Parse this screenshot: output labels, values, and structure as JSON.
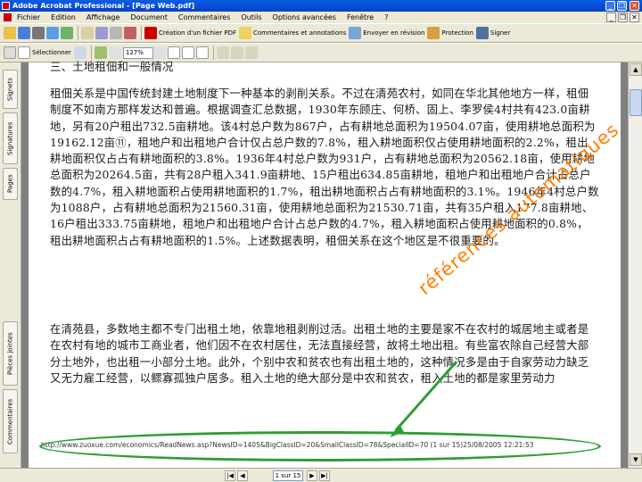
{
  "window": {
    "title": "Adobe Acrobat Professional - [Page Web.pdf]",
    "minimize": "_",
    "restore": "❐",
    "close": "✕"
  },
  "menu": [
    {
      "label": "Fichier"
    },
    {
      "label": "Edition"
    },
    {
      "label": "Affichage"
    },
    {
      "label": "Document"
    },
    {
      "label": "Commentaires"
    },
    {
      "label": "Outils"
    },
    {
      "label": "Options avancées"
    },
    {
      "label": "Fenêtre"
    },
    {
      "label": "?"
    }
  ],
  "toolbar1": {
    "create_pdf": "Création d'un fichier PDF",
    "comment_markup": "Commentaires et annotations",
    "send_for_review": "Envoyer en révision",
    "protection": "Protection",
    "sign": "Signer"
  },
  "toolbar2": {
    "select_tool": "Sélectionner",
    "zoom_value": "127%"
  },
  "navpane": {
    "bookmarks": "Signets",
    "signatures": "Signatures",
    "pages": "Pages",
    "attachments": "Pièces jointes",
    "comments": "Commentaires"
  },
  "document": {
    "heading": "三、土地租佃和一般情况",
    "paragraph1": "租佃关系是中国传统封建土地制度下一种基本的剥削关系。不过在清苑农村，如同在华北其他地方一样，租佃制度不如南方那样发达和普遍。根据调查汇总数据，1930年东顾庄、何桥、固上、李罗侯4村共有423.0亩耕地，另有20户租出732.5亩耕地。该4村总户数为867户，占有耕地总面积为19504.07亩，使用耕地总面积为19162.12亩⑪，租地户和出租地户合计仅占总户数的7.8%，租入耕地面积仅占使用耕地面积的2.2%，租出耕地面积仅占占有耕地面积的3.8%。1936年4村总户数为931户，占有耕地总面积为20562.18亩，使用耕地总面积为20264.5亩，共有28户租入341.9亩耕地、15户租出634.85亩耕地，租地户和出租地户合计占总户数的4.7%，租入耕地面积占使用耕地面积的1.7%，租出耕地面积占占有耕地面积的3.1%。1946年4村总户数为1088户，占有耕地总面积为21560.31亩，使用耕地总面积为21530.71亩，共有35户租入177.8亩耕地、16户租出333.75亩耕地，租地户和出租地户合计占总户数的4.7%，租入耕地面积占使用耕地面积的0.8%，租出耕地面积占占有耕地面积的1.5%。上述数据表明，租佃关系在这个地区是不很重要的。",
    "paragraph2": "在清苑县，多数地主都不专门出租土地，依靠地租剥削过活。出租土地的主要是家不在农村的城居地主或者是在农村有地的城市工商业者，他们因不在农村居住，无法直接经营，故将土地出租。有些富农除自己经营大部分土地外，也出租一小部分土地。此外，个别中农和贫农也有出租土地的，这种情况多是由于自家劳动力缺乏又无力雇工经营，以鳏寡孤独户居多。租入土地的绝大部分是中农和贫农，租入土地的都是家里劳动力",
    "footer_url": "http://www.zuoxue.com/economics/ReadNews.asp?NewsID=1405&BigClassID=20&SmallClassID=78&SpecialID=70 (1 sur 15)25/08/2005 12:21:53",
    "watermark": "références automatiques"
  },
  "annotation": {
    "color": "#2e9e33",
    "watermark_color": "#ff7f00"
  },
  "status": {
    "page_indicator": "1 sur 15",
    "first": "|◀",
    "prev": "◀",
    "next": "▶",
    "last": "▶|"
  },
  "scrollbar": {
    "up": "▲",
    "down": "▼"
  }
}
